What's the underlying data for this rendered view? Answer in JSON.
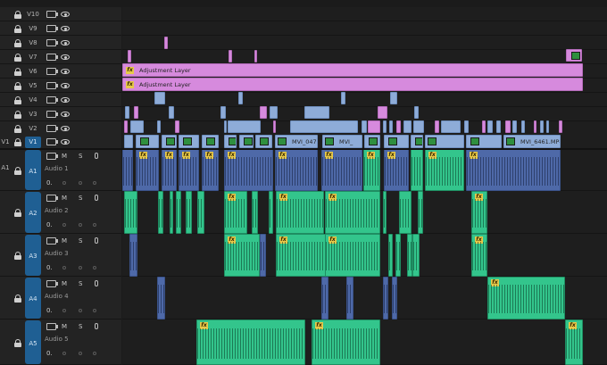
{
  "video_tracks": [
    {
      "id": "V10",
      "source": "",
      "targeted": false
    },
    {
      "id": "V9",
      "source": "",
      "targeted": false
    },
    {
      "id": "V8",
      "source": "",
      "targeted": false
    },
    {
      "id": "V7",
      "source": "",
      "targeted": false
    },
    {
      "id": "V6",
      "source": "",
      "targeted": false
    },
    {
      "id": "V5",
      "source": "",
      "targeted": false
    },
    {
      "id": "V4",
      "source": "",
      "targeted": false
    },
    {
      "id": "V3",
      "source": "",
      "targeted": false
    },
    {
      "id": "V2",
      "source": "",
      "targeted": false
    },
    {
      "id": "V1",
      "source": "V1",
      "targeted": true
    }
  ],
  "audio_tracks": [
    {
      "id": "A1",
      "source": "A1",
      "name": "Audio 1",
      "mute": "M",
      "solo": "S",
      "volume": "0."
    },
    {
      "id": "A2",
      "source": "",
      "name": "Audio 2",
      "mute": "M",
      "solo": "S",
      "volume": "0."
    },
    {
      "id": "A3",
      "source": "",
      "name": "Audio 3",
      "mute": "M",
      "solo": "S",
      "volume": "0."
    },
    {
      "id": "A4",
      "source": "",
      "name": "Audio 4",
      "mute": "M",
      "solo": "S",
      "volume": "0."
    },
    {
      "id": "A5",
      "source": "",
      "name": "Audio 5",
      "mute": "M",
      "solo": "S",
      "volume": "0."
    }
  ],
  "clips": {
    "adjustment_label": "Adjustment Layer",
    "fx_badge": "fx",
    "v1_labels": [
      "MVI_047",
      "MVI_",
      "MVI_6461.MP4 [V]"
    ]
  },
  "colors": {
    "video_clip": "#8eacd8",
    "adjustment_clip": "#d68add",
    "audio_clip_green": "#33c58c",
    "audio_clip_blue": "#4e69a8",
    "target_blue": "#1f5f93"
  }
}
